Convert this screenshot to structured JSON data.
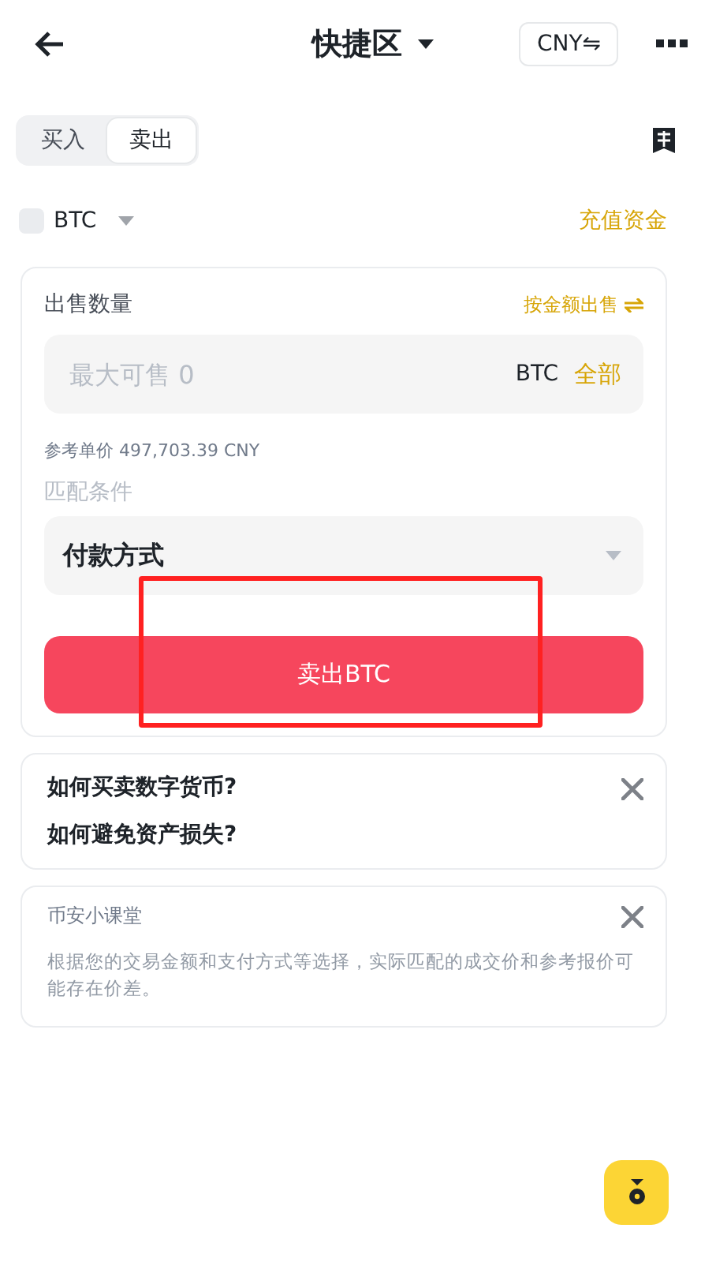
{
  "header": {
    "title": "快捷区",
    "currency": "CNY⇋"
  },
  "tabs": [
    {
      "label": "买入",
      "selected": false
    },
    {
      "label": "卖出",
      "selected": true
    }
  ],
  "asset": {
    "coin": "BTC",
    "deposit_link": "充值资金"
  },
  "sell_form": {
    "amount_label": "出售数量",
    "switch_mode": "按金额出售",
    "amount_field": {
      "placeholder": "最大可售 0",
      "unit": "BTC",
      "max_button": "全部"
    },
    "reference_price": "参考单价 497,703.39 CNY",
    "match_label": "匹配条件",
    "payment_select": "付款方式",
    "submit": {
      "label": "卖出BTC",
      "highlighted": true
    }
  },
  "faq": [
    "如何买卖数字货币?",
    "如何避免资产损失?"
  ],
  "tip": {
    "title": "币安小课堂",
    "text": "根据您的交易金额和支付方式等选择，实际匹配的成交价和参考报价可能存在价差。"
  }
}
